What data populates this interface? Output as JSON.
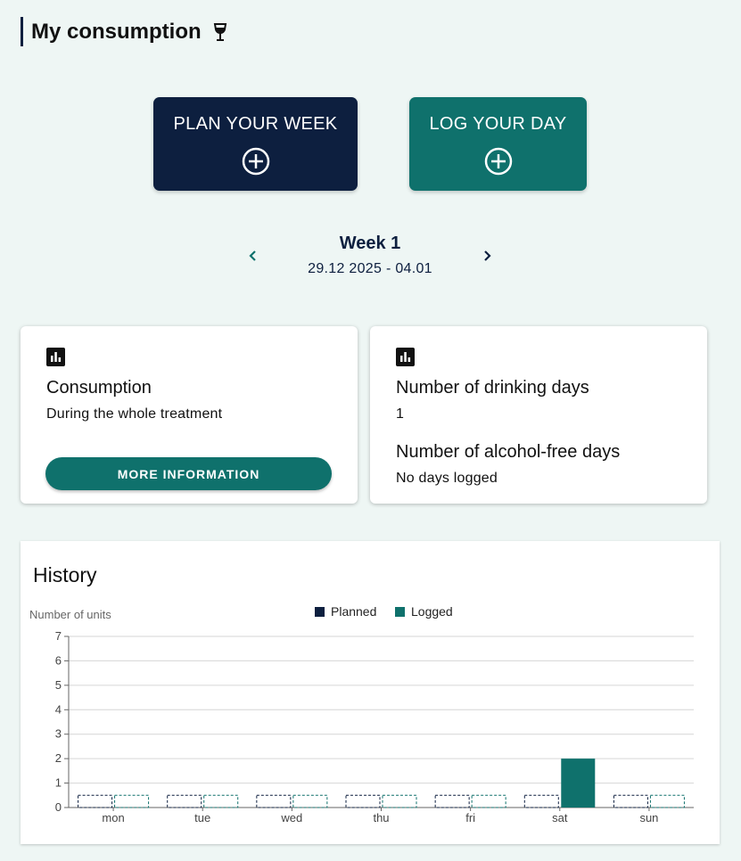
{
  "header": {
    "title": "My consumption",
    "icon": "wine-glass-icon"
  },
  "actions": {
    "plan_label": "PLAN YOUR WEEK",
    "log_label": "LOG YOUR DAY",
    "plan_color": "#0d1f3f",
    "log_color": "#0f716c"
  },
  "week": {
    "title": "Week 1",
    "range": "29.12 2025 - 04.01"
  },
  "consumption_card": {
    "icon": "bar-chart-icon",
    "heading": "Consumption",
    "subtitle": "During the whole treatment",
    "button_label": "MORE INFORMATION"
  },
  "days_card": {
    "icon": "bar-chart-icon",
    "drinking_heading": "Number of drinking days",
    "drinking_value": "1",
    "free_heading": "Number of alcohol-free days",
    "free_value": "No days logged"
  },
  "history": {
    "title": "History"
  },
  "chart_data": {
    "type": "bar",
    "ylabel": "Number of units",
    "xlabel": "",
    "ylim": [
      0,
      7
    ],
    "yticks": [
      0,
      1,
      2,
      3,
      4,
      5,
      6,
      7
    ],
    "grid": true,
    "legend_position": "top-center",
    "categories": [
      "mon",
      "tue",
      "wed",
      "thu",
      "fri",
      "sat",
      "sun"
    ],
    "series": [
      {
        "name": "Planned",
        "color": "#0d1f3f",
        "values": [
          0,
          0,
          0,
          0,
          0,
          0,
          0
        ]
      },
      {
        "name": "Logged",
        "color": "#0f716c",
        "values": [
          0,
          0,
          0,
          0,
          0,
          2,
          0
        ]
      }
    ]
  }
}
